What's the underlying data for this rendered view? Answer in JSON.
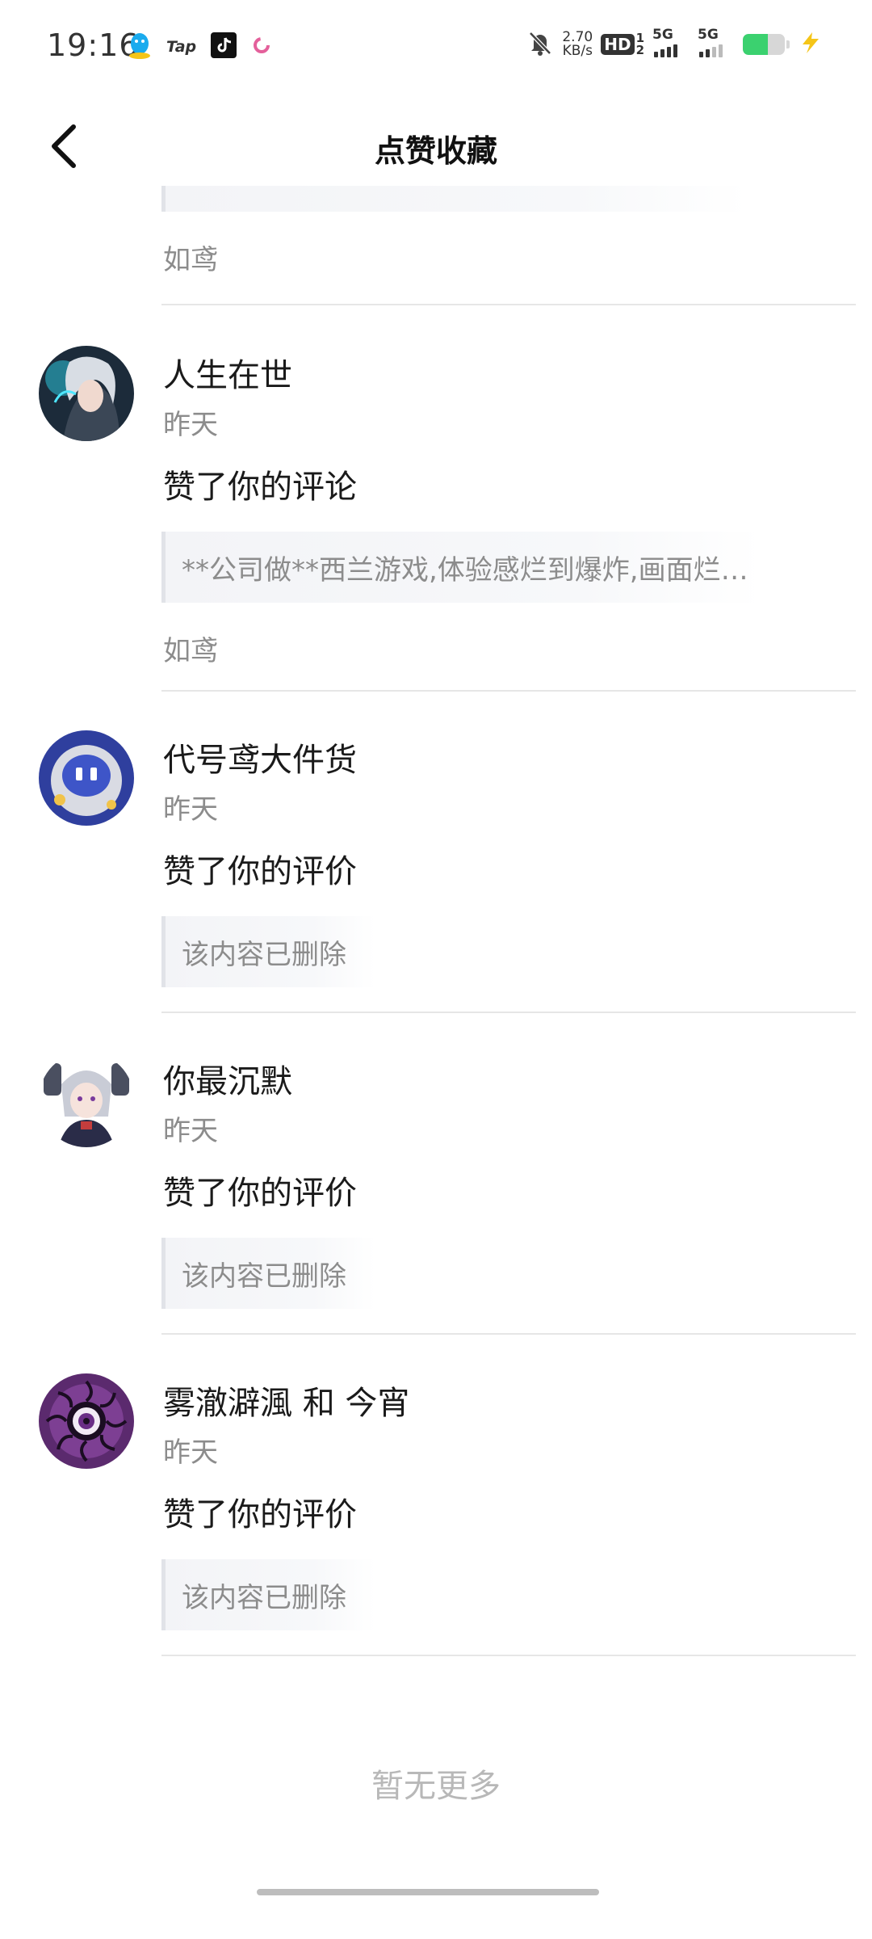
{
  "status_bar": {
    "time": "19:16",
    "tap_label": "Tap",
    "net_speed_value": "2.70",
    "net_speed_unit": "KB/s",
    "hd_label": "HD",
    "hd_sim1": "1",
    "hd_sim2": "2",
    "sig1_label": "5G",
    "sig2_label": "5G",
    "battery_level": 0.6,
    "battery_color": "#3bd16f",
    "charging_color": "#f5c518",
    "icons": [
      "qq-icon",
      "taptap-icon",
      "tiktok-icon",
      "pink-ring-icon",
      "mute-bell-icon",
      "charging-bolt-icon"
    ]
  },
  "header": {
    "title": "点赞收藏"
  },
  "partial_item": {
    "game": "如鸢"
  },
  "items": [
    {
      "username": "人生在世",
      "time": "昨天",
      "action": "赞了你的评论",
      "quote": "**公司做**西兰游戏,体验感烂到爆炸,画面烂…",
      "game": "如鸢",
      "avatar_icon": "avatar-silver-hair-character"
    },
    {
      "username": "代号鸢大件货",
      "time": "昨天",
      "action": "赞了你的评价",
      "quote": "该内容已删除",
      "game": "",
      "avatar_icon": "avatar-robot"
    },
    {
      "username": "你最沉默",
      "time": "昨天",
      "action": "赞了你的评价",
      "quote": "该内容已删除",
      "game": "",
      "avatar_icon": "avatar-anime-girl"
    },
    {
      "username": "雾澈澼渢 和 今宵",
      "time": "昨天",
      "action": "赞了你的评价",
      "quote": "该内容已删除",
      "game": "",
      "avatar_icon": "avatar-purple-eye"
    }
  ],
  "footer": {
    "no_more": "暂无更多"
  },
  "colors": {
    "text_primary": "#1a1a1a",
    "text_secondary": "#8c8c8c",
    "divider": "#e6e6e6",
    "quote_bar": "#e1e3e8",
    "quote_bg": "#f5f6f8"
  }
}
